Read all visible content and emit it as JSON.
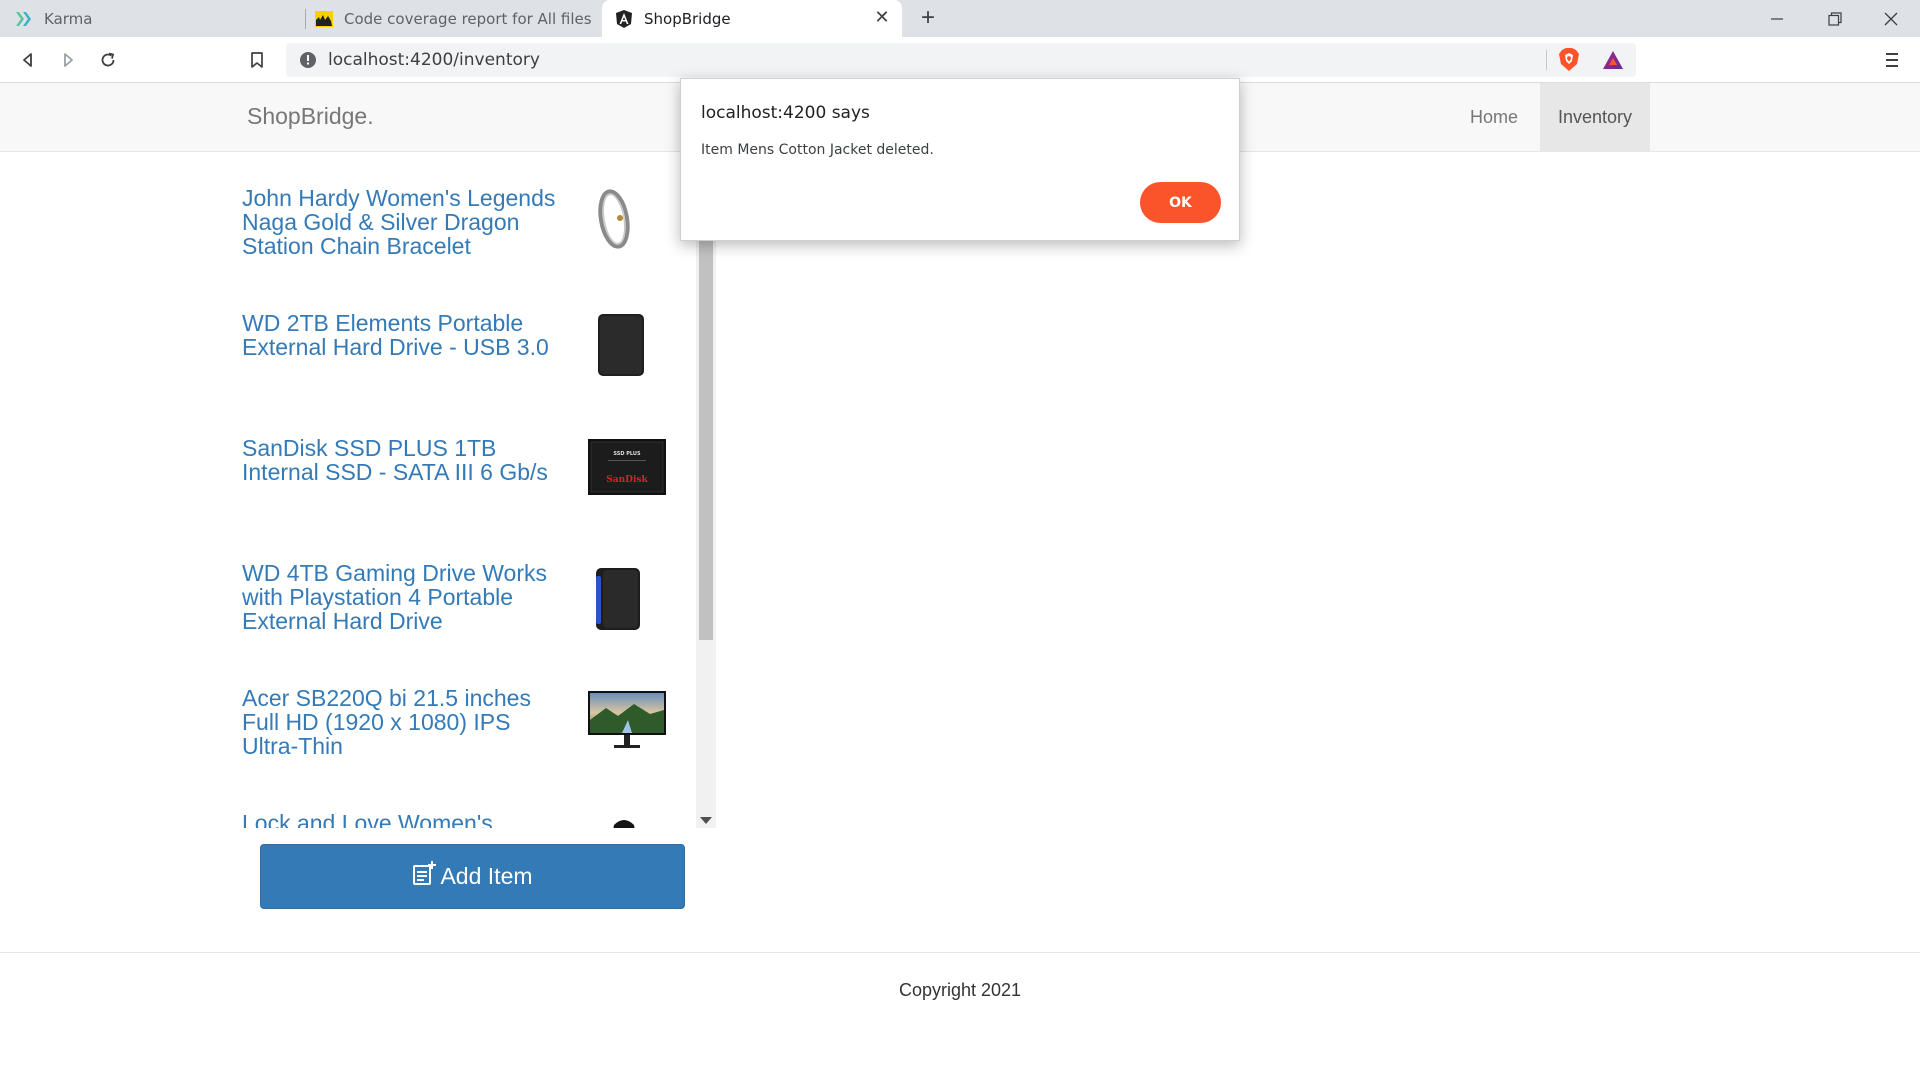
{
  "browser": {
    "tabs": [
      {
        "title": "Karma",
        "favicon": "karma-icon"
      },
      {
        "title": "Code coverage report for All files",
        "favicon": "istanbul-icon"
      },
      {
        "title": "ShopBridge",
        "favicon": "angular-icon"
      }
    ],
    "url": "localhost:4200/inventory"
  },
  "navbar": {
    "brand": "ShopBridge.",
    "links": [
      "Home",
      "Inventory"
    ],
    "active": "Inventory"
  },
  "inventory": {
    "items": [
      {
        "title": "John Hardy Women's Legends Naga Gold & Silver Dragon Station Chain Bracelet",
        "image": "bracelet-image"
      },
      {
        "title": "WD 2TB Elements Portable External Hard Drive - USB 3.0",
        "image": "hard-drive-image"
      },
      {
        "title": "SanDisk SSD PLUS 1TB Internal SSD - SATA III 6 Gb/s",
        "image": "ssd-image",
        "image_text": "SSD PLUS",
        "image_brand": "SanDisk"
      },
      {
        "title": "WD 4TB Gaming Drive Works with Playstation 4 Portable External Hard Drive",
        "image": "gaming-drive-image"
      },
      {
        "title": "Acer SB220Q bi 21.5 inches Full HD (1920 x 1080) IPS Ultra-Thin",
        "image": "monitor-image"
      },
      {
        "title": "Lock and Love Women's",
        "image": "jacket-image"
      }
    ],
    "add_button": "Add Item"
  },
  "footer": {
    "text": "Copyright 2021"
  },
  "alert": {
    "title": "localhost:4200 says",
    "message": "Item Mens Cotton Jacket deleted.",
    "ok": "OK"
  },
  "colors": {
    "link": "#337ab7",
    "primary_button": "#337ab7",
    "alert_ok": "#fb542b"
  }
}
